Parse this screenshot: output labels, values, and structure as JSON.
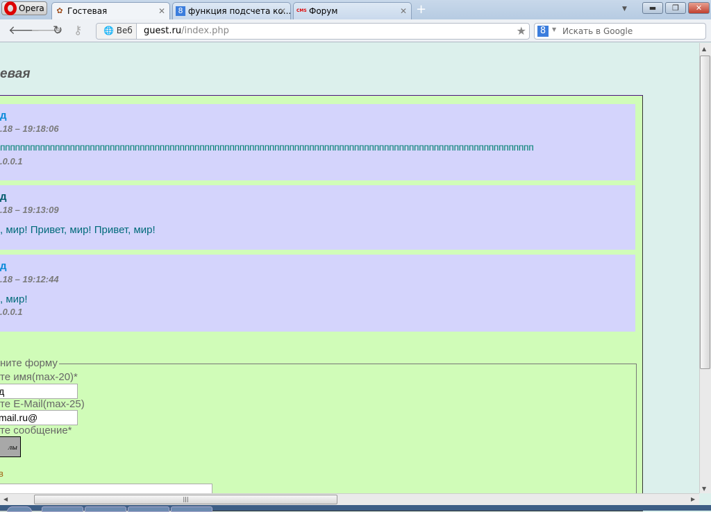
{
  "browser": {
    "opera_label": "Opera",
    "tabs": [
      {
        "label": "Гостевая",
        "active": true
      },
      {
        "label": "функция подсчета ко..."
      },
      {
        "label": "Форум",
        "icon_text": "CMS"
      }
    ],
    "new_tab": "+",
    "address": {
      "web_label": "Веб",
      "host": "guest.ru",
      "path": "/index.php"
    },
    "search_placeholder": "Искать в Google"
  },
  "page": {
    "title": "евая",
    "posts": [
      {
        "name": "д",
        "date": ".18 – 19:18:06",
        "message": "ппппппппппппппппппппппппппппппппппппппппппппппппппппппппппппппппппппппппппппппппппппппппппппппппппппппппппп",
        "ip": ".0.0.1"
      },
      {
        "name": "д",
        "date": ".18 – 19:13:09",
        "message": ", мир! Привет, мир! Привет, мир!",
        "ip": ""
      },
      {
        "name": "д",
        "date": ".18 – 19:12:44",
        "message": ", мир!",
        "ip": ".0.0.1"
      }
    ],
    "form": {
      "legend": "ните форму",
      "name_label": "те имя(max-20)*",
      "name_value": "д",
      "email_label": "те E-Mail(max-25)",
      "email_value": "@mail.ru",
      "message_label": "те сообщение*",
      "smiles_button": "лы",
      "hint": "в"
    }
  },
  "colors": {
    "page_bg": "#dcf0ec",
    "container_bg": "#d0fcb8",
    "post_bg": "#d4d4fc",
    "name": "#0a8ad8",
    "message": "#006a7a"
  }
}
